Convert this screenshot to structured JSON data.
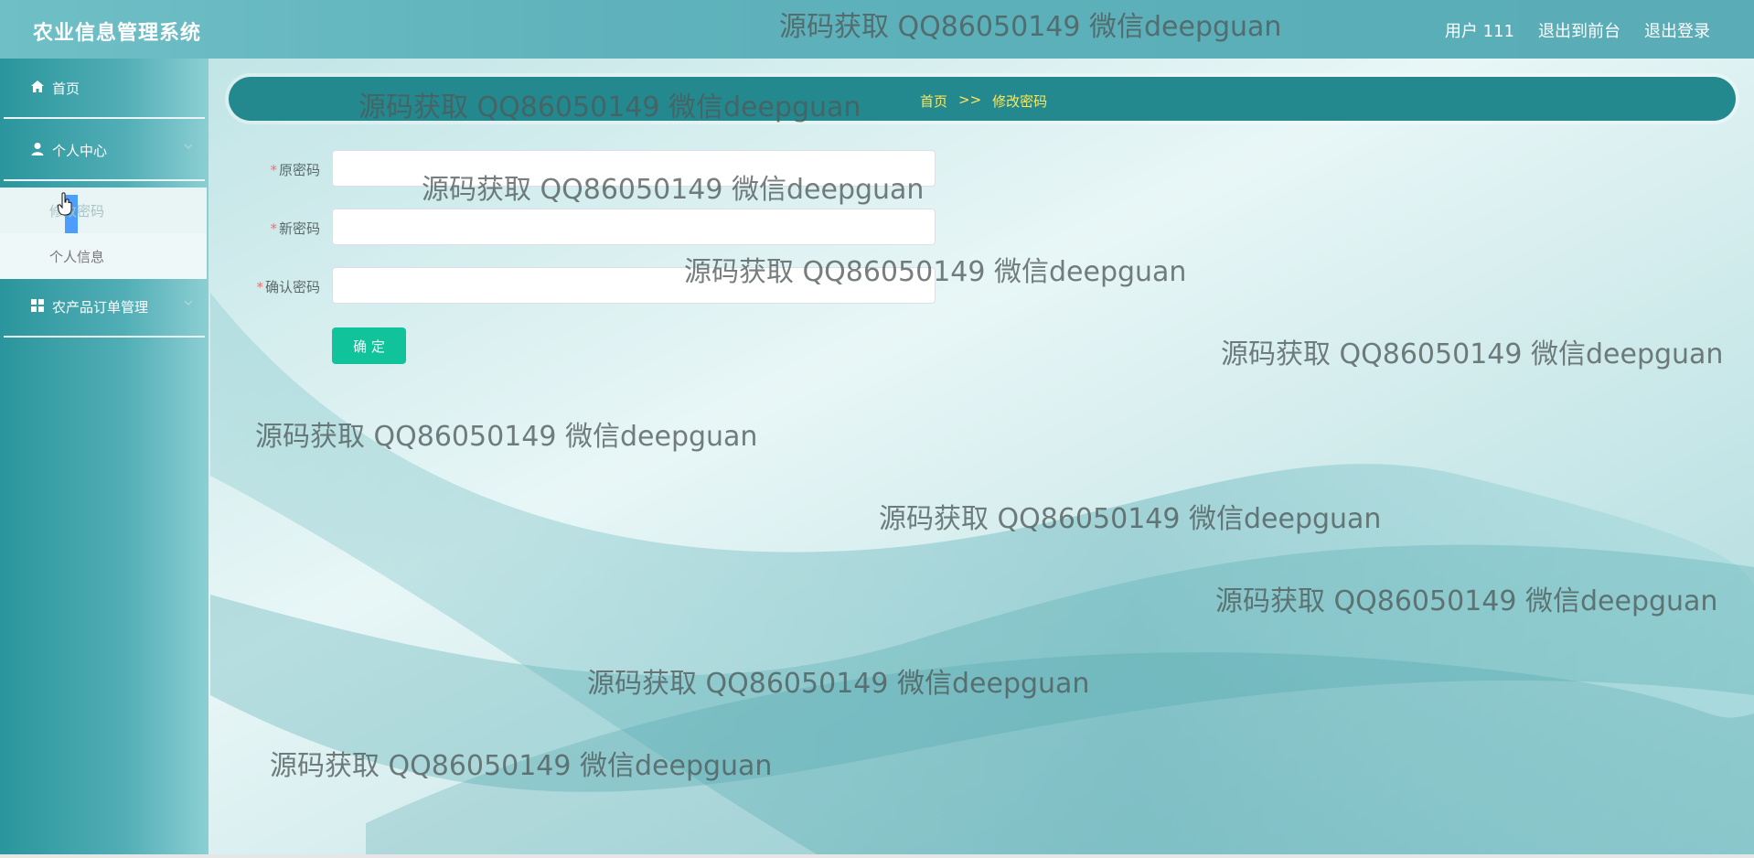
{
  "header": {
    "app_title": "农业信息管理系统",
    "links": [
      "用户 111",
      "退出到前台",
      "退出登录"
    ]
  },
  "sidebar": {
    "items": [
      {
        "label": "首页",
        "icon": "home-icon"
      },
      {
        "label": "个人中心",
        "icon": "user-icon"
      },
      {
        "label": "农产品订单管理",
        "icon": "grid-icon"
      }
    ],
    "submenu": [
      {
        "label": "修改密码"
      },
      {
        "label": "个人信息"
      }
    ]
  },
  "breadcrumb": {
    "home": "首页",
    "separator": ">>",
    "current": "修改密码"
  },
  "form": {
    "fields": [
      {
        "label": "原密码",
        "value": ""
      },
      {
        "label": "新密码",
        "value": ""
      },
      {
        "label": "确认密码",
        "value": ""
      }
    ],
    "submit_label": "确 定"
  },
  "watermark": "源码获取 QQ86050149 微信deepguan",
  "colors": {
    "header": "#5fb2bb",
    "crumb_bar": "#23898f",
    "crumb_text": "#ffe85a",
    "submit": "#11c39a",
    "required": "#f56c6c"
  }
}
